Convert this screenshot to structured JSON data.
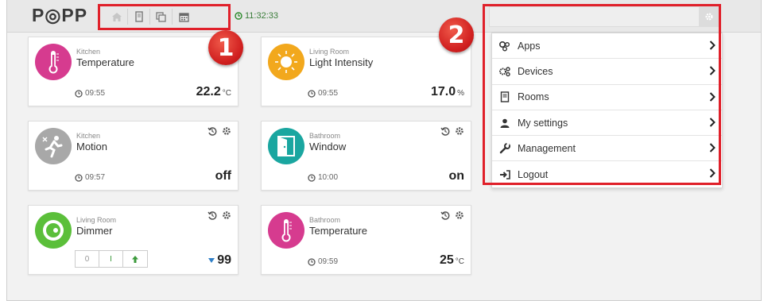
{
  "header": {
    "logo": "P◎PP",
    "clock": "11:32:33"
  },
  "callouts": {
    "one": "1",
    "two": "2"
  },
  "menu": {
    "items": [
      {
        "icon": "apps-icon",
        "label": "Apps"
      },
      {
        "icon": "devices-icon",
        "label": "Devices"
      },
      {
        "icon": "rooms-icon",
        "label": "Rooms"
      },
      {
        "icon": "user-icon",
        "label": "My settings"
      },
      {
        "icon": "wrench-icon",
        "label": "Management"
      },
      {
        "icon": "logout-icon",
        "label": "Logout"
      }
    ]
  },
  "cards": [
    {
      "room": "Kitchen",
      "name": "Temperature",
      "time": "09:55",
      "value": "22.2",
      "unit": "°C"
    },
    {
      "room": "Living Room",
      "name": "Light Intensity",
      "time": "09:55",
      "value": "17.0",
      "unit": "%"
    },
    {
      "room": "Kitchen",
      "name": "Motion",
      "time": "09:57",
      "value": "off",
      "unit": ""
    },
    {
      "room": "Bathroom",
      "name": "Window",
      "time": "10:00",
      "value": "on",
      "unit": ""
    },
    {
      "room": "Living Room",
      "name": "Dimmer",
      "time": "",
      "value": "99",
      "unit": "",
      "stepper": [
        "0",
        "I",
        "↑"
      ]
    },
    {
      "room": "Bathroom",
      "name": "Temperature",
      "time": "09:59",
      "value": "25",
      "unit": "°C"
    }
  ],
  "colors": {
    "highlight": "#e0202a",
    "clock": "#2b8a2b",
    "thermo": "#d63b8f",
    "light": "#f2a81d",
    "motion": "#a8a8a8",
    "window": "#1aa6a0",
    "dimmer": "#5bbf3a"
  }
}
